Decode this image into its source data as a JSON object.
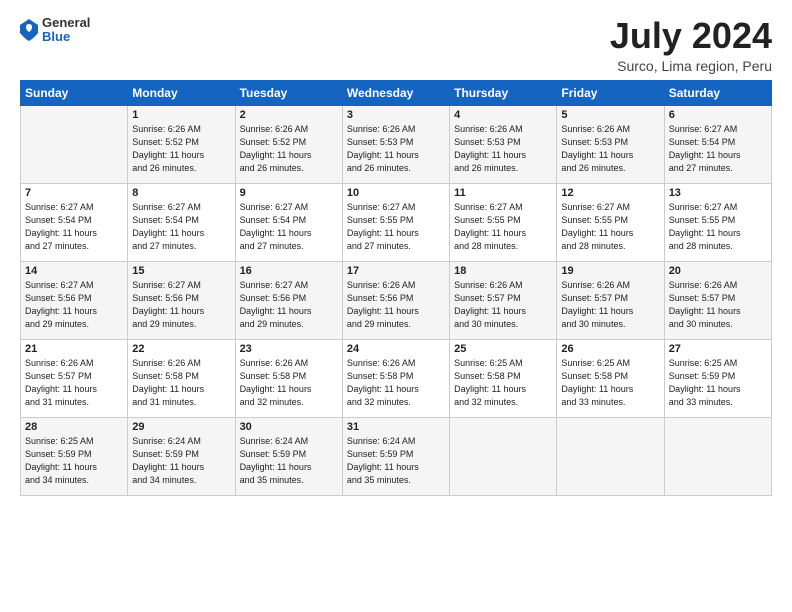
{
  "logo": {
    "general": "General",
    "blue": "Blue"
  },
  "header": {
    "month_year": "July 2024",
    "location": "Surco, Lima region, Peru"
  },
  "weekdays": [
    "Sunday",
    "Monday",
    "Tuesday",
    "Wednesday",
    "Thursday",
    "Friday",
    "Saturday"
  ],
  "weeks": [
    [
      {
        "day": "",
        "info": ""
      },
      {
        "day": "1",
        "info": "Sunrise: 6:26 AM\nSunset: 5:52 PM\nDaylight: 11 hours\nand 26 minutes."
      },
      {
        "day": "2",
        "info": "Sunrise: 6:26 AM\nSunset: 5:52 PM\nDaylight: 11 hours\nand 26 minutes."
      },
      {
        "day": "3",
        "info": "Sunrise: 6:26 AM\nSunset: 5:53 PM\nDaylight: 11 hours\nand 26 minutes."
      },
      {
        "day": "4",
        "info": "Sunrise: 6:26 AM\nSunset: 5:53 PM\nDaylight: 11 hours\nand 26 minutes."
      },
      {
        "day": "5",
        "info": "Sunrise: 6:26 AM\nSunset: 5:53 PM\nDaylight: 11 hours\nand 26 minutes."
      },
      {
        "day": "6",
        "info": "Sunrise: 6:27 AM\nSunset: 5:54 PM\nDaylight: 11 hours\nand 27 minutes."
      }
    ],
    [
      {
        "day": "7",
        "info": "Sunrise: 6:27 AM\nSunset: 5:54 PM\nDaylight: 11 hours\nand 27 minutes."
      },
      {
        "day": "8",
        "info": "Sunrise: 6:27 AM\nSunset: 5:54 PM\nDaylight: 11 hours\nand 27 minutes."
      },
      {
        "day": "9",
        "info": "Sunrise: 6:27 AM\nSunset: 5:54 PM\nDaylight: 11 hours\nand 27 minutes."
      },
      {
        "day": "10",
        "info": "Sunrise: 6:27 AM\nSunset: 5:55 PM\nDaylight: 11 hours\nand 27 minutes."
      },
      {
        "day": "11",
        "info": "Sunrise: 6:27 AM\nSunset: 5:55 PM\nDaylight: 11 hours\nand 28 minutes."
      },
      {
        "day": "12",
        "info": "Sunrise: 6:27 AM\nSunset: 5:55 PM\nDaylight: 11 hours\nand 28 minutes."
      },
      {
        "day": "13",
        "info": "Sunrise: 6:27 AM\nSunset: 5:55 PM\nDaylight: 11 hours\nand 28 minutes."
      }
    ],
    [
      {
        "day": "14",
        "info": "Sunrise: 6:27 AM\nSunset: 5:56 PM\nDaylight: 11 hours\nand 29 minutes."
      },
      {
        "day": "15",
        "info": "Sunrise: 6:27 AM\nSunset: 5:56 PM\nDaylight: 11 hours\nand 29 minutes."
      },
      {
        "day": "16",
        "info": "Sunrise: 6:27 AM\nSunset: 5:56 PM\nDaylight: 11 hours\nand 29 minutes."
      },
      {
        "day": "17",
        "info": "Sunrise: 6:26 AM\nSunset: 5:56 PM\nDaylight: 11 hours\nand 29 minutes."
      },
      {
        "day": "18",
        "info": "Sunrise: 6:26 AM\nSunset: 5:57 PM\nDaylight: 11 hours\nand 30 minutes."
      },
      {
        "day": "19",
        "info": "Sunrise: 6:26 AM\nSunset: 5:57 PM\nDaylight: 11 hours\nand 30 minutes."
      },
      {
        "day": "20",
        "info": "Sunrise: 6:26 AM\nSunset: 5:57 PM\nDaylight: 11 hours\nand 30 minutes."
      }
    ],
    [
      {
        "day": "21",
        "info": "Sunrise: 6:26 AM\nSunset: 5:57 PM\nDaylight: 11 hours\nand 31 minutes."
      },
      {
        "day": "22",
        "info": "Sunrise: 6:26 AM\nSunset: 5:58 PM\nDaylight: 11 hours\nand 31 minutes."
      },
      {
        "day": "23",
        "info": "Sunrise: 6:26 AM\nSunset: 5:58 PM\nDaylight: 11 hours\nand 32 minutes."
      },
      {
        "day": "24",
        "info": "Sunrise: 6:26 AM\nSunset: 5:58 PM\nDaylight: 11 hours\nand 32 minutes."
      },
      {
        "day": "25",
        "info": "Sunrise: 6:25 AM\nSunset: 5:58 PM\nDaylight: 11 hours\nand 32 minutes."
      },
      {
        "day": "26",
        "info": "Sunrise: 6:25 AM\nSunset: 5:58 PM\nDaylight: 11 hours\nand 33 minutes."
      },
      {
        "day": "27",
        "info": "Sunrise: 6:25 AM\nSunset: 5:59 PM\nDaylight: 11 hours\nand 33 minutes."
      }
    ],
    [
      {
        "day": "28",
        "info": "Sunrise: 6:25 AM\nSunset: 5:59 PM\nDaylight: 11 hours\nand 34 minutes."
      },
      {
        "day": "29",
        "info": "Sunrise: 6:24 AM\nSunset: 5:59 PM\nDaylight: 11 hours\nand 34 minutes."
      },
      {
        "day": "30",
        "info": "Sunrise: 6:24 AM\nSunset: 5:59 PM\nDaylight: 11 hours\nand 35 minutes."
      },
      {
        "day": "31",
        "info": "Sunrise: 6:24 AM\nSunset: 5:59 PM\nDaylight: 11 hours\nand 35 minutes."
      },
      {
        "day": "",
        "info": ""
      },
      {
        "day": "",
        "info": ""
      },
      {
        "day": "",
        "info": ""
      }
    ]
  ]
}
